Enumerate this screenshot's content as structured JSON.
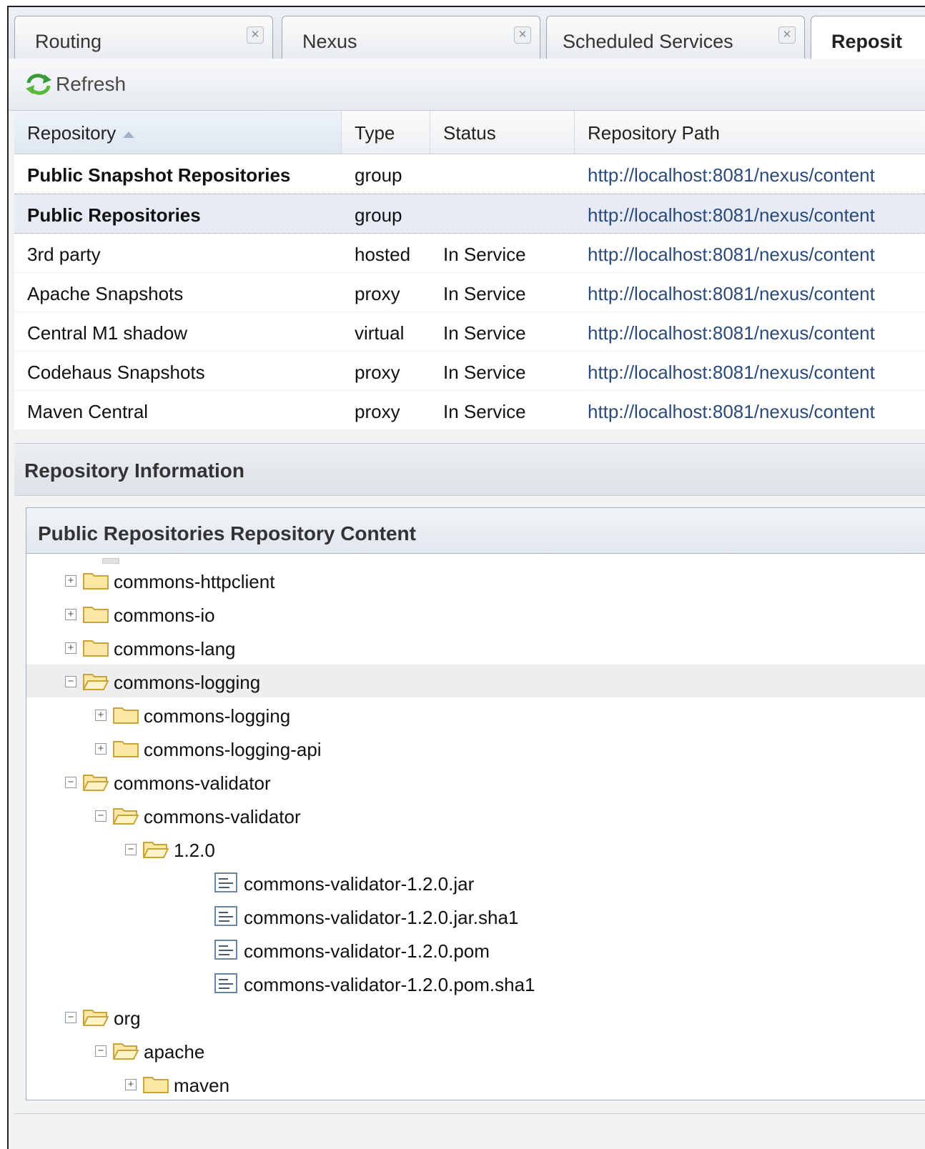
{
  "tabs": [
    {
      "label": "Routing",
      "close_icon": "close-icon"
    },
    {
      "label": "Nexus",
      "close_icon": "close-icon"
    },
    {
      "label": "Scheduled Services",
      "close_icon": "close-icon"
    },
    {
      "label": "Reposit",
      "active": true
    }
  ],
  "toolbar": {
    "refresh_label": "Refresh",
    "refresh_icon": "refresh-icon"
  },
  "grid": {
    "columns": [
      "Repository",
      "Type",
      "Status",
      "Repository Path"
    ],
    "sorted_column": "Repository",
    "rows": [
      {
        "name": "Public Snapshot Repositories",
        "type": "group",
        "status": "",
        "path": "http://localhost:8081/nexus/content",
        "bold": true
      },
      {
        "name": "Public Repositories",
        "type": "group",
        "status": "",
        "path": "http://localhost:8081/nexus/content",
        "bold": true,
        "selected": true
      },
      {
        "name": "3rd party",
        "type": "hosted",
        "status": "In Service",
        "path": "http://localhost:8081/nexus/content"
      },
      {
        "name": "Apache Snapshots",
        "type": "proxy",
        "status": "In Service",
        "path": "http://localhost:8081/nexus/content"
      },
      {
        "name": "Central M1 shadow",
        "type": "virtual",
        "status": "In Service",
        "path": "http://localhost:8081/nexus/content"
      },
      {
        "name": "Codehaus Snapshots",
        "type": "proxy",
        "status": "In Service",
        "path": "http://localhost:8081/nexus/content"
      },
      {
        "name": "Maven Central",
        "type": "proxy",
        "status": "In Service",
        "path": "http://localhost:8081/nexus/content"
      }
    ]
  },
  "info": {
    "header": "Repository Information",
    "content_title": "Public Repositories Repository Content"
  },
  "tree": [
    {
      "label": "commons-httpclient",
      "depth": 0,
      "kind": "folder",
      "expanded": false
    },
    {
      "label": "commons-io",
      "depth": 0,
      "kind": "folder",
      "expanded": false
    },
    {
      "label": "commons-lang",
      "depth": 0,
      "kind": "folder",
      "expanded": false
    },
    {
      "label": "commons-logging",
      "depth": 0,
      "kind": "folder",
      "expanded": true,
      "highlight": true
    },
    {
      "label": "commons-logging",
      "depth": 1,
      "kind": "folder",
      "expanded": false
    },
    {
      "label": "commons-logging-api",
      "depth": 1,
      "kind": "folder",
      "expanded": false
    },
    {
      "label": "commons-validator",
      "depth": 0,
      "kind": "folder",
      "expanded": true
    },
    {
      "label": "commons-validator",
      "depth": 1,
      "kind": "folder",
      "expanded": true
    },
    {
      "label": "1.2.0",
      "depth": 2,
      "kind": "folder",
      "expanded": true
    },
    {
      "label": "commons-validator-1.2.0.jar",
      "depth": 3,
      "kind": "file"
    },
    {
      "label": "commons-validator-1.2.0.jar.sha1",
      "depth": 3,
      "kind": "file"
    },
    {
      "label": "commons-validator-1.2.0.pom",
      "depth": 3,
      "kind": "file"
    },
    {
      "label": "commons-validator-1.2.0.pom.sha1",
      "depth": 3,
      "kind": "file"
    },
    {
      "label": "org",
      "depth": 0,
      "kind": "folder",
      "expanded": true
    },
    {
      "label": "apache",
      "depth": 1,
      "kind": "folder",
      "expanded": true
    },
    {
      "label": "maven",
      "depth": 2,
      "kind": "folder",
      "expanded": false
    }
  ],
  "colors": {
    "link": "#2c4a78",
    "selection": "#e6ebf5",
    "panel_border": "#9fb0c4"
  }
}
